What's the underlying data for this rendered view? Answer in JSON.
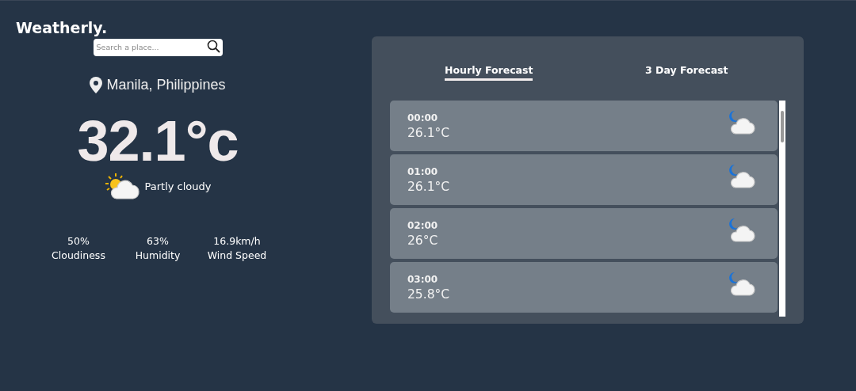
{
  "app": {
    "logo": "Weatherly."
  },
  "search": {
    "placeholder": "Search a place..."
  },
  "current": {
    "location": "Manila, Philippines",
    "temperature": "32.1°c",
    "condition": "Partly cloudy"
  },
  "stats": [
    {
      "value": "50%",
      "label": "Cloudiness"
    },
    {
      "value": "63%",
      "label": "Humidity"
    },
    {
      "value": "16.9km/h",
      "label": "Wind Speed"
    }
  ],
  "tabs": [
    {
      "label": "Hourly Forecast",
      "selected": true
    },
    {
      "label": "3 Day Forecast",
      "selected": false
    }
  ],
  "hourly": [
    {
      "time": "00:00",
      "temp": "26.1°C"
    },
    {
      "time": "01:00",
      "temp": "26.1°C"
    },
    {
      "time": "02:00",
      "temp": "26°C"
    },
    {
      "time": "03:00",
      "temp": "25.8°C"
    }
  ]
}
